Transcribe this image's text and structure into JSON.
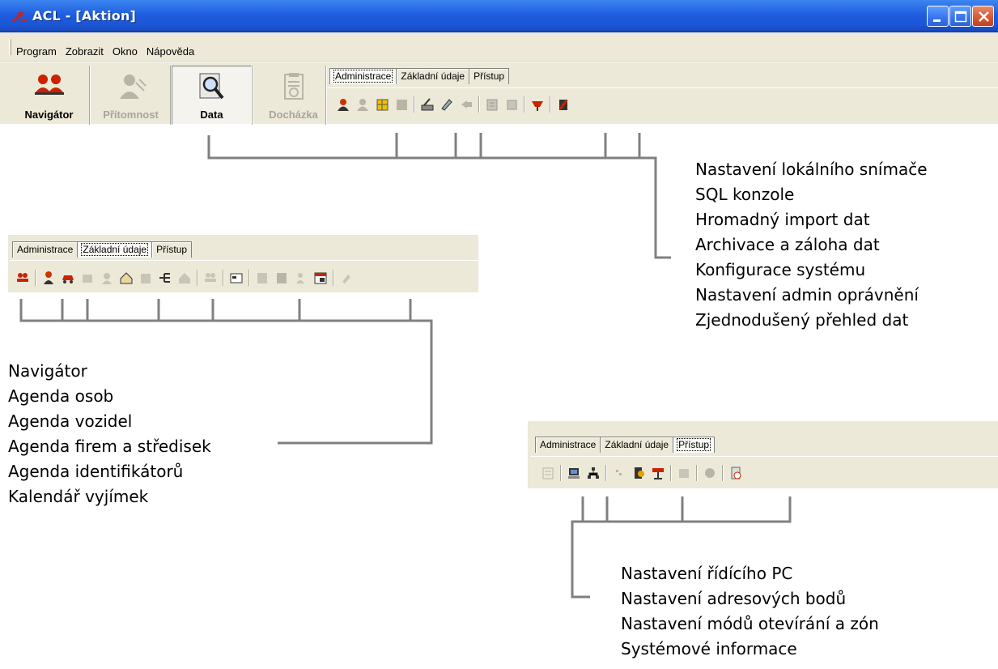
{
  "window": {
    "title": "ACL - [Aktion]",
    "colors": {
      "titlebar": "#1f5ee0",
      "face": "#ece9d8",
      "accent_red": "#cc2200"
    },
    "controls": [
      "minimize-icon",
      "maximize-icon",
      "close-icon"
    ]
  },
  "menubar": {
    "items": [
      "Program",
      "Zobrazit",
      "Okno",
      "Nápověda"
    ]
  },
  "main_toolbar": {
    "buttons": [
      {
        "label": "Navigátor",
        "icon": "people-icon",
        "state": "normal"
      },
      {
        "label": "Přítomnost",
        "icon": "person-disabled-icon",
        "state": "disabled"
      },
      {
        "label": "Data",
        "icon": "magnifier-icon",
        "state": "pressed"
      },
      {
        "label": "Docházka",
        "icon": "clipboard-icon",
        "state": "disabled"
      }
    ]
  },
  "tabs": {
    "labels": [
      "Administrace",
      "Základní údaje",
      "Přístup"
    ]
  },
  "panel_admin": {
    "active_tab": "Administrace",
    "icons": [
      "admin-person-icon",
      "admin-gray-icon",
      "yellow-grid-icon",
      "gray-box-icon",
      "separator",
      "scanner-icon",
      "pen-icon",
      "import-icon",
      "separator",
      "archive-icon",
      "server-icon",
      "separator",
      "red-chart-icon",
      "separator",
      "tablet-icon"
    ]
  },
  "panel_basic": {
    "active_tab": "Základní údaje",
    "icons": [
      "group-icon",
      "separator",
      "person-icon",
      "car-icon",
      "company-gray-icon",
      "id-gray-icon",
      "house-icon",
      "building-gray-icon",
      "tree-icon",
      "home-gray-icon",
      "separator",
      "group-gray-icon",
      "separator",
      "card-icon",
      "separator",
      "book-gray-icon",
      "box-gray-icon",
      "person-arrow-gray-icon",
      "calendar-icon",
      "separator",
      "eraser-icon"
    ]
  },
  "panel_access": {
    "active_tab": "Přístup",
    "icons": [
      "list-gray-icon",
      "separator",
      "computer-icon",
      "network-icon",
      "separator",
      "small-gray-icon",
      "door-icon",
      "zone-icon",
      "separator",
      "refresh-gray-icon",
      "separator",
      "circle-gray-icon",
      "separator",
      "clock-icon"
    ]
  },
  "labels_admin": [
    "Nastavení lokálního snímače",
    "SQL konzole",
    "Hromadný import dat",
    "Archivace a záloha dat",
    "Konfigurace systému",
    "Nastavení admin oprávnění",
    "Zjednodušený přehled dat"
  ],
  "labels_basic": [
    "Navigátor",
    "Agenda osob",
    "Agenda vozidel",
    "Agenda firem a středisek",
    "Agenda identifikátorů",
    "Kalendář vyjímek"
  ],
  "labels_access": [
    "Nastavení řídícího PC",
    "Nastavení adresových bodů",
    "Nastavení módů otevírání a zón",
    "Systémové informace"
  ]
}
